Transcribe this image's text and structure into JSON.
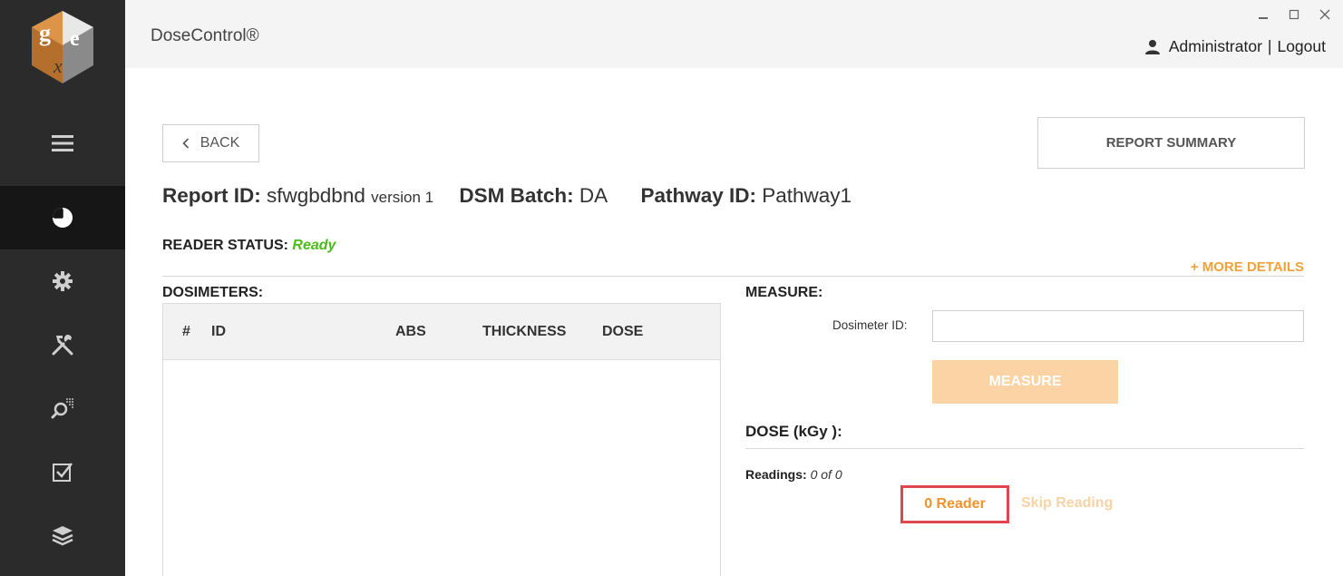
{
  "app": {
    "title": "DoseControl®"
  },
  "user": {
    "name": "Administrator",
    "separator": "|",
    "logout": "Logout"
  },
  "toolbar": {
    "back_label": "BACK",
    "report_summary_label": "REPORT SUMMARY"
  },
  "report": {
    "id_label": "Report ID:",
    "id_value": "sfwgbdbnd",
    "version": "version 1",
    "batch_label": "DSM Batch:",
    "batch_value": "DA",
    "pathway_label": "Pathway ID:",
    "pathway_value": "Pathway1"
  },
  "reader_status": {
    "label": "READER STATUS:",
    "value": "Ready",
    "value_color": "#4cbb17"
  },
  "more_details": "+ MORE DETAILS",
  "dosimeters": {
    "title": "DOSIMETERS:",
    "columns": [
      "#",
      "ID",
      "ABS",
      "THICKNESS",
      "DOSE"
    ],
    "rows": []
  },
  "measure": {
    "title": "MEASURE:",
    "dosimeter_label": "Dosimeter ID:",
    "dosimeter_value": "",
    "button_label": "MEASURE"
  },
  "dose": {
    "title": "DOSE (kGy ):",
    "readings_label": "Readings:",
    "readings_value": "0 of 0",
    "reader_button": "0 Reader",
    "skip_label": "Skip Reading"
  },
  "sidebar": {
    "items": [
      {
        "icon": "menu-icon",
        "active": false
      },
      {
        "icon": "pie-chart-icon",
        "active": true
      },
      {
        "icon": "gear-icon",
        "active": false
      },
      {
        "icon": "tools-icon",
        "active": false
      },
      {
        "icon": "search-icon",
        "active": false
      },
      {
        "icon": "checkbox-icon",
        "active": false
      },
      {
        "icon": "layers-icon",
        "active": false
      }
    ]
  },
  "colors": {
    "accent": "#f0a23b",
    "sidebar_bg": "#2b2b2b",
    "highlight": "#e0474c",
    "ready": "#4cbb17"
  }
}
